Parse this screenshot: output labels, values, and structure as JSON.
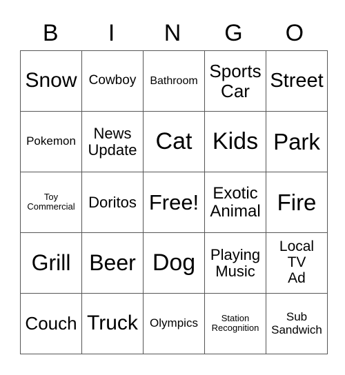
{
  "header": [
    "B",
    "I",
    "N",
    "G",
    "O"
  ],
  "board": [
    [
      {
        "text": "Snow",
        "size": 30
      },
      {
        "text": "Cowboy",
        "size": 19
      },
      {
        "text": "Bathroom",
        "size": 16
      },
      {
        "text": "Sports\nCar",
        "size": 26
      },
      {
        "text": "Street",
        "size": 29
      }
    ],
    [
      {
        "text": "Pokemon",
        "size": 17
      },
      {
        "text": "News\nUpdate",
        "size": 22
      },
      {
        "text": "Cat",
        "size": 34
      },
      {
        "text": "Kids",
        "size": 34
      },
      {
        "text": "Park",
        "size": 33
      }
    ],
    [
      {
        "text": "Toy\nCommercial",
        "size": 13
      },
      {
        "text": "Doritos",
        "size": 22
      },
      {
        "text": "Free!",
        "size": 31
      },
      {
        "text": "Exotic\nAnimal",
        "size": 24
      },
      {
        "text": "Fire",
        "size": 33
      }
    ],
    [
      {
        "text": "Grill",
        "size": 32
      },
      {
        "text": "Beer",
        "size": 32
      },
      {
        "text": "Dog",
        "size": 34
      },
      {
        "text": "Playing\nMusic",
        "size": 22
      },
      {
        "text": "Local\nTV\nAd",
        "size": 21
      }
    ],
    [
      {
        "text": "Couch",
        "size": 26
      },
      {
        "text": "Truck",
        "size": 30
      },
      {
        "text": "Olympics",
        "size": 17
      },
      {
        "text": "Station\nRecognition",
        "size": 13
      },
      {
        "text": "Sub\nSandwich",
        "size": 17
      }
    ]
  ]
}
